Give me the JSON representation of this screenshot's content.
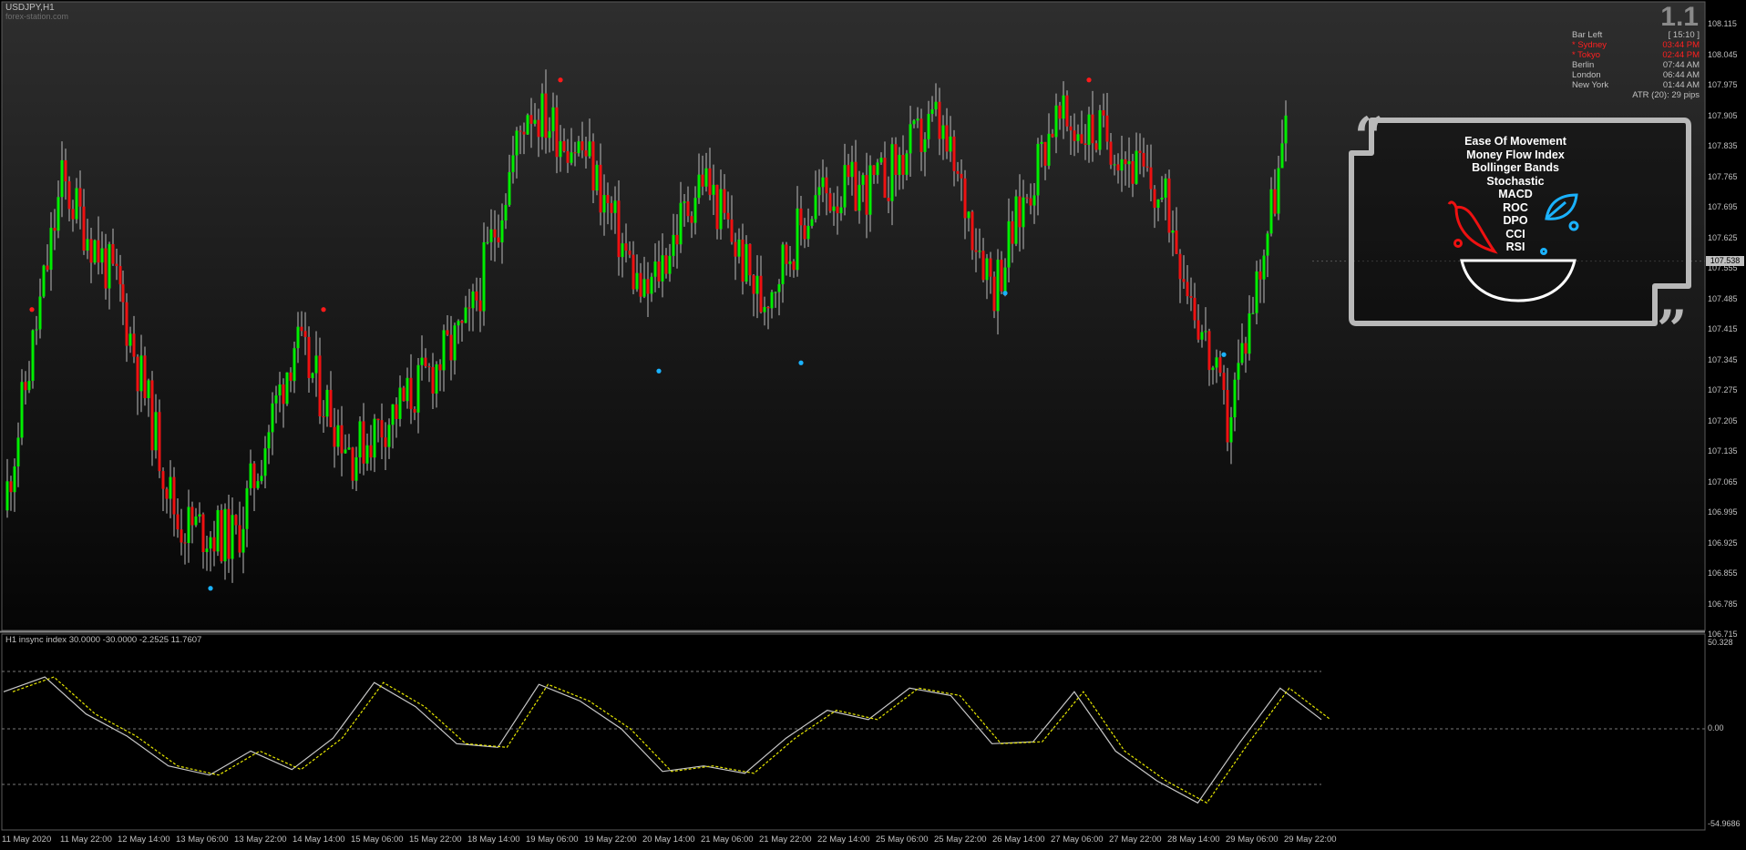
{
  "window": {
    "symbol_title": "USDJPY,H1",
    "watermark": "forex-station.com",
    "version_badge": "1.1"
  },
  "info_panel": [
    {
      "label": "Bar Left",
      "value": "[ 15:10 ]",
      "color": "#c0c0c0"
    },
    {
      "label": "* Sydney",
      "value": "03:44 PM",
      "color": "#ff2020"
    },
    {
      "label": "* Tokyo",
      "value": "02:44 PM",
      "color": "#ff2020"
    },
    {
      "label": "Berlin",
      "value": "07:44 AM",
      "color": "#c0c0c0"
    },
    {
      "label": "London",
      "value": "06:44 AM",
      "color": "#c0c0c0"
    },
    {
      "label": "New York",
      "value": "01:44 AM",
      "color": "#c0c0c0"
    }
  ],
  "atr_text": "ATR (20): 29 pips",
  "logo_box": {
    "indicators": [
      "Ease Of Movement",
      "Money Flow Index",
      "Bollinger Bands",
      "Stochastic",
      "MACD",
      "ROC",
      "DPO",
      "CCI",
      "RSI"
    ],
    "icons": [
      "quote-open-icon",
      "quote-close-icon",
      "chili-pepper-icon",
      "leaf-icon",
      "bowl-icon"
    ]
  },
  "price_axis": [
    "108.115",
    "108.045",
    "107.975",
    "107.905",
    "107.835",
    "107.765",
    "107.695",
    "107.625",
    "107.555",
    "107.485",
    "107.415",
    "107.345",
    "107.275",
    "107.205",
    "107.135",
    "107.065",
    "106.995",
    "106.925",
    "106.855",
    "106.785",
    "106.715"
  ],
  "current_price": "107.538",
  "subwindow": {
    "title": "H1 insync index 30.0000 -30.0000 -2.2525 11.7607",
    "axis": [
      "50.328",
      "0.00",
      "-54.9686"
    ]
  },
  "time_axis": [
    "11 May 2020",
    "11 May 22:00",
    "12 May 14:00",
    "13 May 06:00",
    "13 May 22:00",
    "14 May 14:00",
    "15 May 06:00",
    "15 May 22:00",
    "18 May 14:00",
    "19 May 06:00",
    "19 May 22:00",
    "20 May 14:00",
    "21 May 06:00",
    "21 May 22:00",
    "22 May 14:00",
    "25 May 06:00",
    "25 May 22:00",
    "26 May 14:00",
    "27 May 06:00",
    "27 May 22:00",
    "28 May 14:00",
    "29 May 06:00",
    "29 May 22:00"
  ],
  "colors": {
    "bull": "#00ee00",
    "bear": "#ee1111",
    "upper_signal": "#ff1a1a",
    "lower_signal": "#1ab2ff",
    "wick": "#bbbbbb",
    "fast_line": "#c8c8c8",
    "slow_line": "#e6e600"
  },
  "chart_data": {
    "type": "line",
    "x": [
      "11 May 2020",
      "11 May 22:00",
      "12 May 14:00",
      "13 May 06:00",
      "13 May 22:00",
      "14 May 14:00",
      "15 May 06:00",
      "15 May 22:00",
      "18 May 14:00",
      "19 May 06:00",
      "19 May 22:00",
      "20 May 14:00",
      "21 May 06:00",
      "21 May 22:00",
      "22 May 14:00",
      "25 May 06:00",
      "25 May 22:00",
      "26 May 14:00",
      "27 May 06:00",
      "27 May 22:00",
      "28 May 14:00",
      "29 May 06:00",
      "29 May 22:00"
    ],
    "series": [
      {
        "values": [
          106.93,
          107.73,
          107.46,
          106.9,
          106.86,
          107.34,
          107.07,
          107.21,
          107.38,
          107.92,
          107.8,
          107.44,
          107.75,
          107.44,
          107.7,
          107.72,
          107.88,
          107.48,
          107.88,
          107.84,
          107.66,
          107.14,
          107.84
        ]
      }
    ],
    "ylim": [
      106.69,
      108.15
    ],
    "current_price": 107.538
  }
}
